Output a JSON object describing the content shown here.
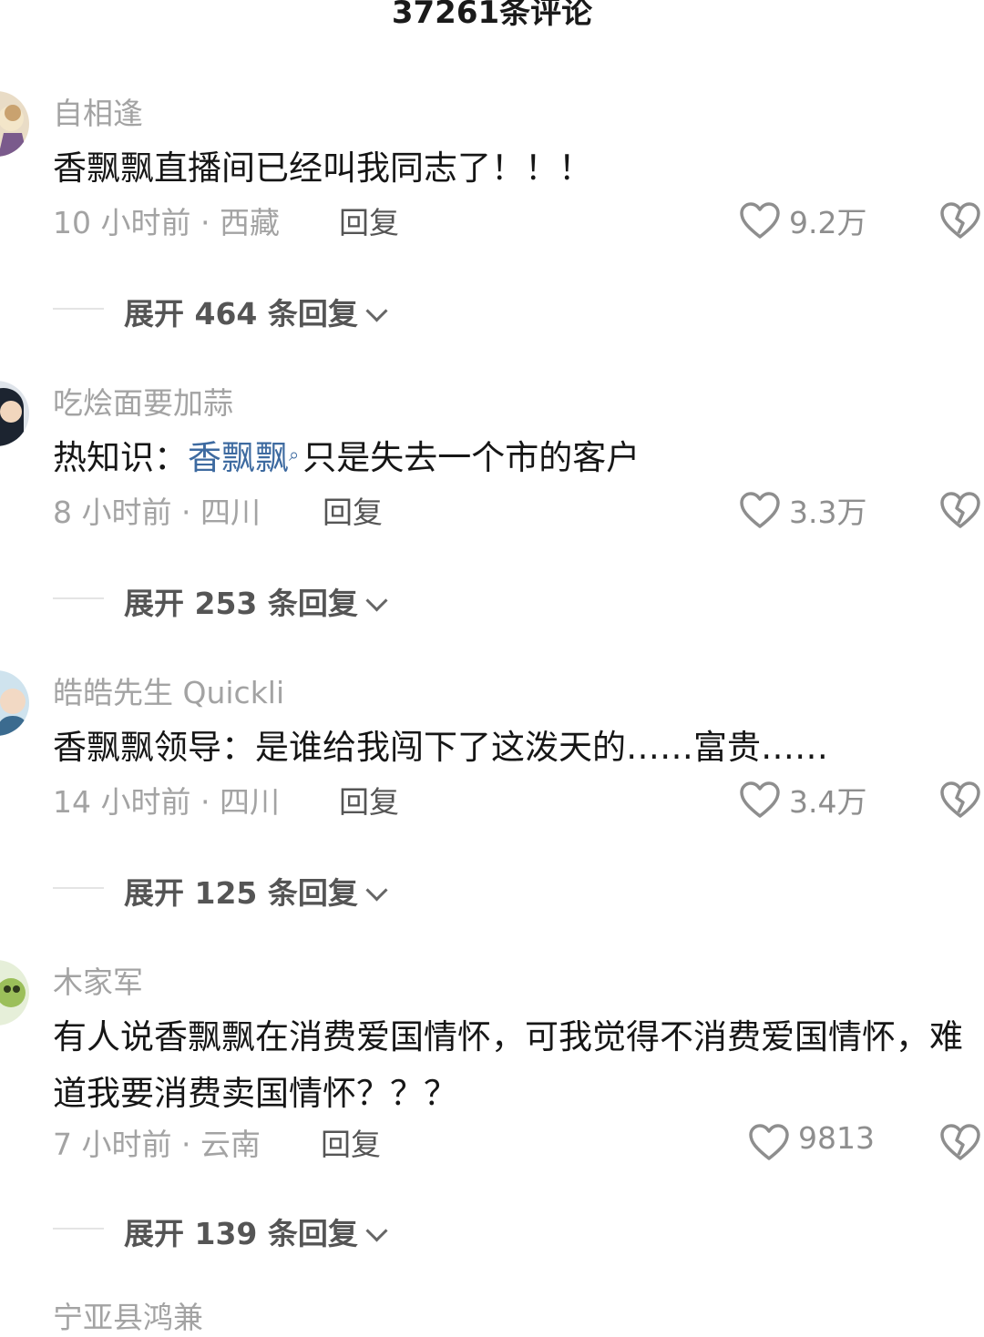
{
  "header": {
    "title": "37261条评论"
  },
  "comments": [
    {
      "username": "自相逢",
      "content": "香飘飘直播间已经叫我同志了！！！",
      "time_location": "10 小时前 · 西藏",
      "reply_label": "回复",
      "likes": "9.2万",
      "expand_label": "展开 464 条回复"
    },
    {
      "username": "吃烩面要加蒜",
      "content_prefix": "热知识：",
      "mention": "香飘飘",
      "content_suffix": "只是失去一个市的客户",
      "time_location": "8 小时前 · 四川",
      "reply_label": "回复",
      "likes": "3.3万",
      "expand_label": "展开 253 条回复"
    },
    {
      "username": "皓皓先生 Quickli",
      "content": "香飘飘领导：是谁给我闯下了这泼天的……富贵……",
      "time_location": "14 小时前 · 四川",
      "reply_label": "回复",
      "likes": "3.4万",
      "expand_label": "展开 125 条回复"
    },
    {
      "username": "木家军",
      "content": "有人说香飘飘在消费爱国情怀，可我觉得不消费爱国情怀，难道我要消费卖国情怀？？？",
      "time_location": "7 小时前 · 云南",
      "reply_label": "回复",
      "likes": "9813",
      "expand_label": "展开 139 条回复"
    }
  ],
  "next_comment": {
    "username": "宁亚县鸿兼"
  },
  "icons": {
    "like": "heart-outline-icon",
    "dislike": "broken-heart-icon",
    "expand": "chevron-down-icon",
    "mention": "search-icon"
  },
  "colors": {
    "mention": "#3d6aa0",
    "meta": "#a3a3a3",
    "text": "#161616"
  }
}
